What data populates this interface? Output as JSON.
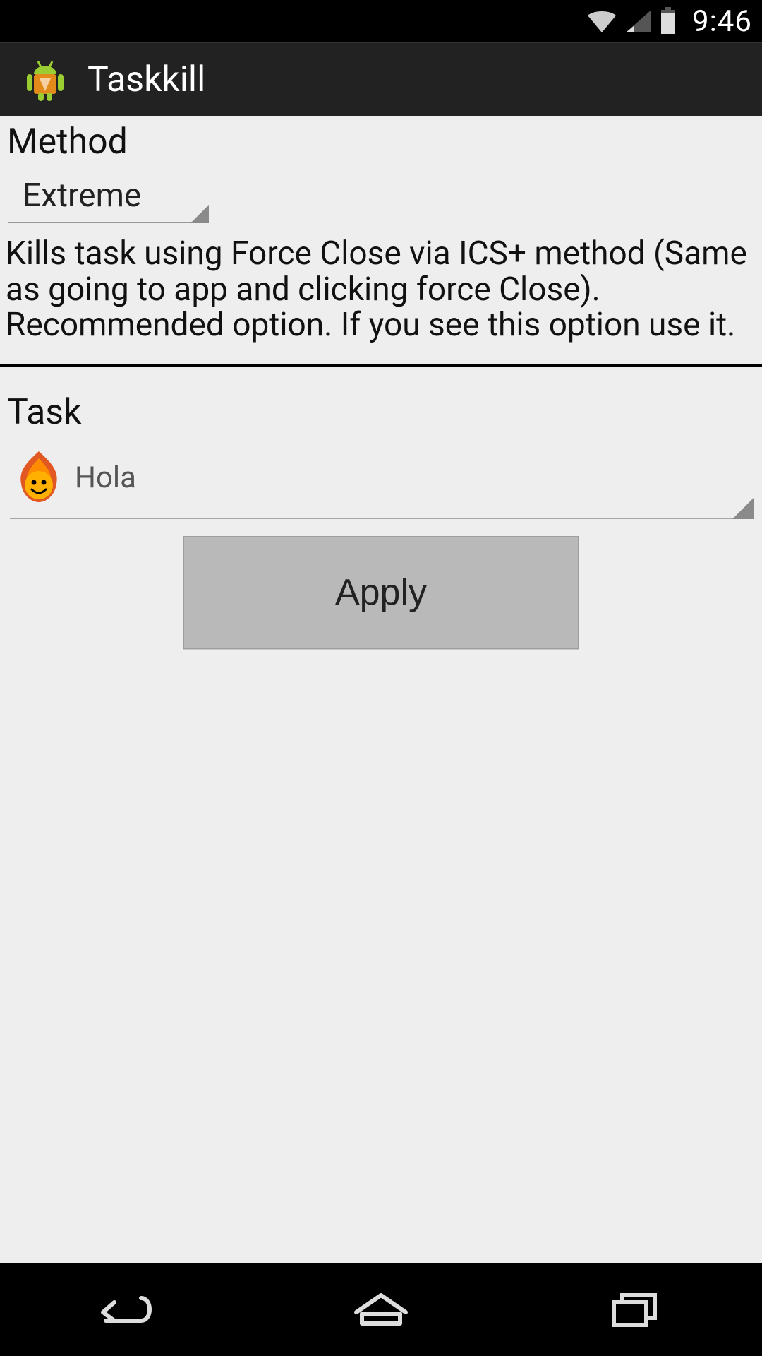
{
  "status": {
    "time": "9:46"
  },
  "app": {
    "title": "Taskkill"
  },
  "method": {
    "label": "Method",
    "selected": "Extreme",
    "description": "Kills task using Force Close via ICS+ method (Same as going to app and clicking force Close).\nRecommended option. If you see this option use it."
  },
  "task": {
    "label": "Task",
    "selected": "Hola"
  },
  "buttons": {
    "apply": "Apply"
  }
}
